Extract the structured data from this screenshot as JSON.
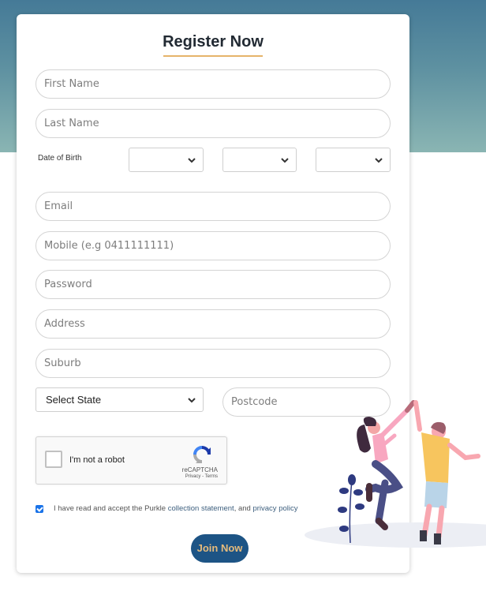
{
  "header": {
    "title": "Register Now"
  },
  "form": {
    "first_name": {
      "placeholder": "First Name",
      "value": ""
    },
    "last_name": {
      "placeholder": "Last Name",
      "value": ""
    },
    "dob": {
      "label": "Date of Birth",
      "day": {
        "selected": ""
      },
      "month": {
        "selected": ""
      },
      "year": {
        "selected": ""
      }
    },
    "email": {
      "placeholder": "Email",
      "value": ""
    },
    "mobile": {
      "placeholder": "Mobile (e.g 0411111111)",
      "value": ""
    },
    "password": {
      "placeholder": "Password",
      "value": ""
    },
    "address": {
      "placeholder": "Address",
      "value": ""
    },
    "suburb": {
      "placeholder": "Suburb",
      "value": ""
    },
    "state": {
      "selected": "Select State"
    },
    "postcode": {
      "placeholder": "Postcode",
      "value": ""
    }
  },
  "recaptcha": {
    "label": "I'm not a robot",
    "brand": "reCAPTCHA",
    "links": "Privacy - Terms",
    "checked": false
  },
  "consent": {
    "checked": true,
    "text_prefix": "I have read and accept the Purkle ",
    "link1": "collection statement",
    "text_middle": ", and ",
    "link2": "privacy policy"
  },
  "actions": {
    "join_label": "Join Now"
  },
  "colors": {
    "accent": "#1d5485",
    "button_text": "#e6bb7c",
    "underline": "#e6b46a",
    "band_top": "#457a97",
    "band_bottom": "#8ab5b3"
  }
}
